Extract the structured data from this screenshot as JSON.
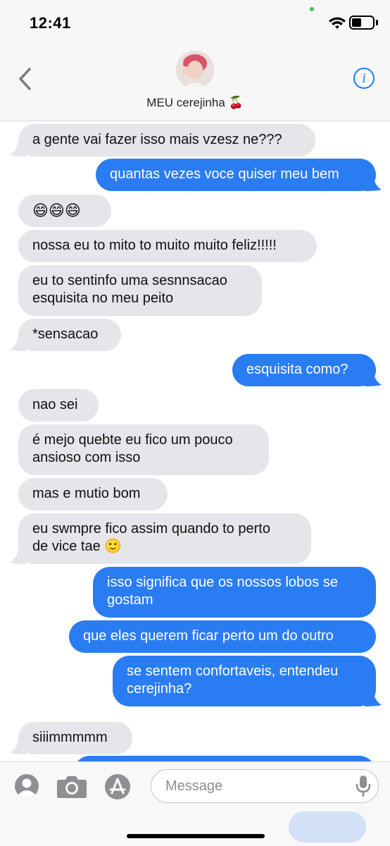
{
  "status_bar": {
    "time": "12:41"
  },
  "header": {
    "contact_name": "MEU cerejinha 🍒"
  },
  "messages": [
    {
      "side": "in",
      "text": "a gente vai fazer isso mais vzesz ne???"
    },
    {
      "side": "out",
      "text": "quantas vezes voce quiser meu bem"
    },
    {
      "side": "in",
      "text": "😄😄😄"
    },
    {
      "side": "in",
      "text": "nossa eu to mito to muito muito feliz!!!!!"
    },
    {
      "side": "in",
      "text": "eu to sentinfo uma sesnnsacao",
      "text2": "esquisita no meu peito"
    },
    {
      "side": "in",
      "text": "*sensacao"
    },
    {
      "side": "out",
      "text": "esquisita como?"
    },
    {
      "side": "in",
      "text": "nao sei"
    },
    {
      "side": "in",
      "text": "é mejo quebte eu fico um pouco",
      "text2": "ansioso com isso"
    },
    {
      "side": "in",
      "text": "mas e mutio bom"
    },
    {
      "side": "in",
      "text": "eu swmpre fico assim quando to perto",
      "text2": "de vice tae 🙂"
    },
    {
      "side": "out",
      "text": "isso significa que os nossos lobos se",
      "text2": "gostam"
    },
    {
      "side": "out",
      "text": "que eles querem ficar perto um do outro"
    },
    {
      "side": "out",
      "text": "se sentem confortaveis, entendeu",
      "text2": "cerejinha?"
    },
    {
      "side": "in",
      "text": "siiimmmmm"
    }
  ],
  "composer": {
    "placeholder": "Message"
  },
  "colors": {
    "outgoing": "#2a7cf2",
    "incoming": "#e5e5ea",
    "accent": "#1d7cf2"
  }
}
